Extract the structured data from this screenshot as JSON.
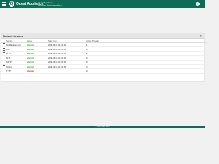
{
  "header": {
    "brand": "Quest Appliance",
    "app_subtitle": "Quest Appliance",
    "app_title": "Service Administration",
    "help_label": "?"
  },
  "card": {
    "title": "Network Services",
    "refresh_symbol": "↻"
  },
  "table": {
    "columns": [
      "",
      "Service",
      "Status",
      "Start Time",
      "Active Threads"
    ],
    "rows": [
      {
        "name": "NetManagement",
        "status": "Started",
        "start_time": "2019-04-15 08:45:09",
        "threads": "1"
      },
      {
        "name": "FTP",
        "status": "Started",
        "start_time": "2019-04-15 08:45:09",
        "threads": "0"
      },
      {
        "name": "HTTP",
        "status": "Started",
        "start_time": "2019-04-15 08:45:09",
        "threads": "2"
      },
      {
        "name": "NTP",
        "status": "Started",
        "start_time": "2019-04-15 08:45:09",
        "threads": "0"
      },
      {
        "name": "SMTP",
        "status": "Started",
        "start_time": "2019-04-15 08:45:09",
        "threads": "0"
      },
      {
        "name": "Syslog",
        "status": "Started",
        "start_time": "2019-04-15 08:45:09",
        "threads": "0"
      },
      {
        "name": "TFTP",
        "status": "Stopped",
        "start_time": "",
        "threads": "0"
      }
    ]
  },
  "footer": {
    "text": "© 2019 ABC Corp"
  },
  "colors": {
    "header_bg": "#0e6b55",
    "started": "#2e9b2e",
    "stopped": "#d22b2b"
  }
}
